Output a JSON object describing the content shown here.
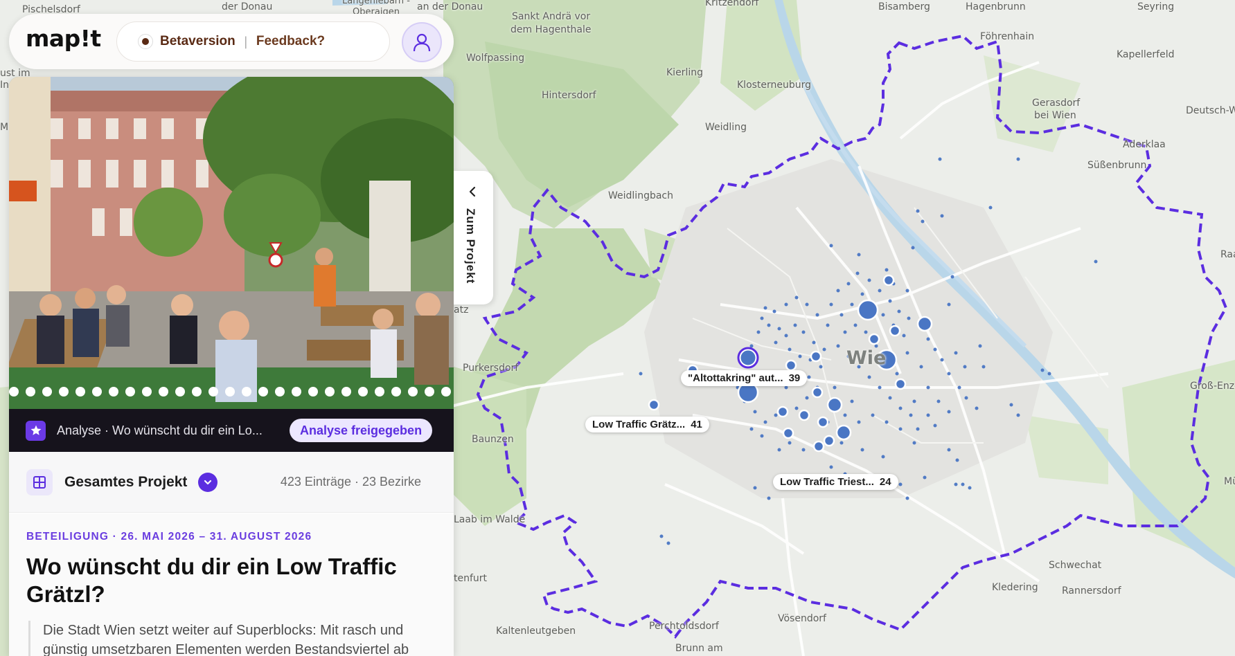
{
  "header": {
    "logo": "map!t",
    "beta_label": "Betaversion",
    "separator": "|",
    "feedback_label": "Feedback?",
    "user_icon": "user-icon"
  },
  "map": {
    "places": [
      "Pischelsdorf",
      "der Donau",
      "Langenlebarn - Oberaigen",
      "an der Donau",
      "Kritzendorf",
      "Bisamberg",
      "Hagenbrunn",
      "Seyring",
      "Sankt Andrä vor",
      "dem Hagenthale",
      "Föhrenhain",
      "Kapellerfeld",
      "Wolfpassing",
      "Kierling",
      "Klosterneuburg",
      "Hintersdorf",
      "Gerasdorf",
      "bei Wien",
      "Deutsch-W",
      "Weidling",
      "Aderklaa",
      "Süßenbrunn",
      "Weidlingbach",
      "Raa",
      "Wie",
      "Purkersdorf",
      "Groß-Enzers",
      "Baunzen",
      "Laab im Walde",
      "Schwechat",
      "Kledering",
      "Rannersdorf",
      "Vösendorf",
      "Perchtoldsdorf",
      "Kaltenleutgeben",
      "Brunn am",
      "tenfurt",
      "Mü",
      "ust im",
      "Ine",
      "Mic",
      "atz"
    ],
    "cluster_labels": [
      {
        "name": "\"Altottakring\" aut...",
        "count": "39"
      },
      {
        "name": "Low Traffic Grätz...",
        "count": "41"
      },
      {
        "name": "Low Traffic Triest...",
        "count": "24"
      }
    ],
    "boundary_color": "#5b2de0",
    "point_color": "#4a76c4"
  },
  "side_tab": {
    "label": "Zum Projekt"
  },
  "gallery": {
    "dot_count": 27
  },
  "analysis": {
    "title": "Analyse · Wo wünscht du dir ein Lo...",
    "badge": "Analyse freigegeben"
  },
  "scope": {
    "label": "Gesamtes Projekt",
    "stats": "423 Einträge · 23 Bezirke"
  },
  "project": {
    "phase": "BETEILIGUNG · 26. MAI 2026 – 31. AUGUST 2026",
    "title": "Wo wünscht du dir ein Low Traffic Grätzl?",
    "description": "Die Stadt Wien setzt weiter auf Superblocks: Mit rasch und günstig umsetzbaren Elementen werden Bestandsviertel ab"
  },
  "colors": {
    "accent": "#5b2de0",
    "brand_brown": "#5a2a14"
  }
}
